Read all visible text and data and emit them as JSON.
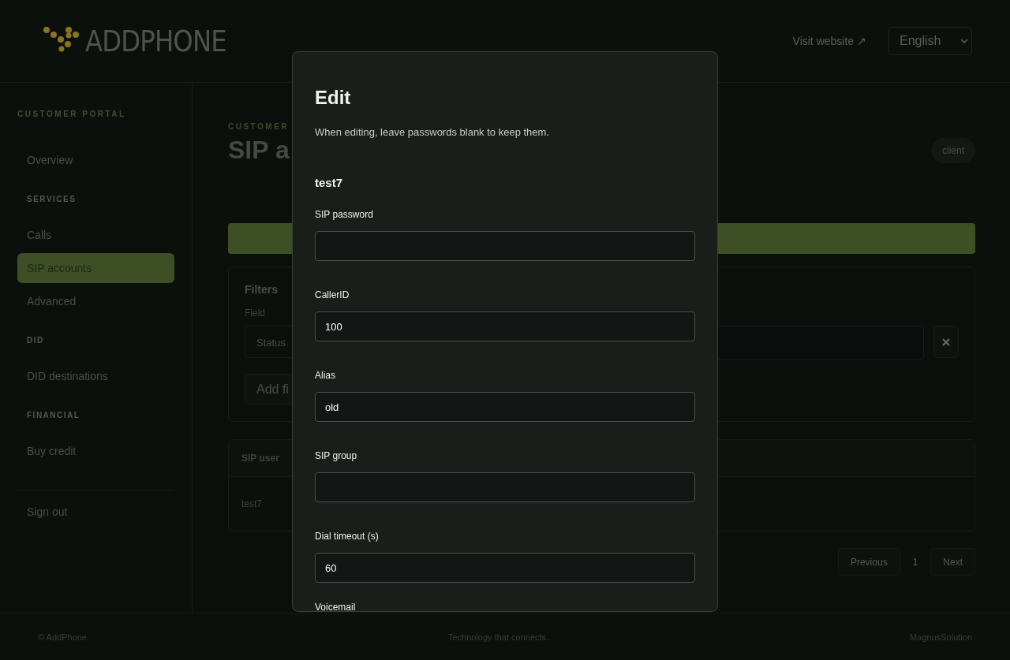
{
  "header": {
    "logo": "ADDPHONE",
    "visit_link": "Visit website ↗",
    "language": "English"
  },
  "sidebar": {
    "title": "CUSTOMER PORTAL",
    "groups": [
      {
        "items": [
          {
            "label": "Overview",
            "selected": false
          }
        ]
      },
      {
        "heading": "SERVICES",
        "items": [
          {
            "label": "Calls",
            "selected": false
          },
          {
            "label": "SIP accounts",
            "selected": true
          },
          {
            "label": "Advanced",
            "selected": false
          }
        ]
      },
      {
        "heading": "DID",
        "items": [
          {
            "label": "DID destinations",
            "selected": false
          }
        ]
      },
      {
        "heading": "FINANCIAL",
        "items": [
          {
            "label": "Buy credit",
            "selected": false
          }
        ]
      }
    ],
    "sign_out": "Sign out"
  },
  "main": {
    "eyebrow": "CUSTOMER",
    "title": "SIP a",
    "role_badge": "client",
    "filters": {
      "title": "Filters",
      "field_label": "Field",
      "field_value": "Status",
      "add_button": "Add fi"
    },
    "table": {
      "columns": [
        "SIP user"
      ],
      "rows": [
        [
          "test7"
        ]
      ]
    },
    "pagination": {
      "previous": "Previous",
      "page": "1",
      "next": "Next"
    }
  },
  "modal": {
    "title": "Edit",
    "hint": "When editing, leave passwords blank to keep them.",
    "account": "test7",
    "fields": [
      {
        "label": "SIP password"
      },
      {
        "label": "CallerID",
        "value": "100"
      },
      {
        "label": "Alias",
        "value": "old"
      },
      {
        "label": "SIP group"
      },
      {
        "label": "Dial timeout (s)",
        "value": "60"
      }
    ],
    "next_label": "Voicemail"
  },
  "footer": {
    "copyright": "© AddPhone",
    "tagline": "Technology that connects.",
    "credit": "MagnusSolution"
  }
}
